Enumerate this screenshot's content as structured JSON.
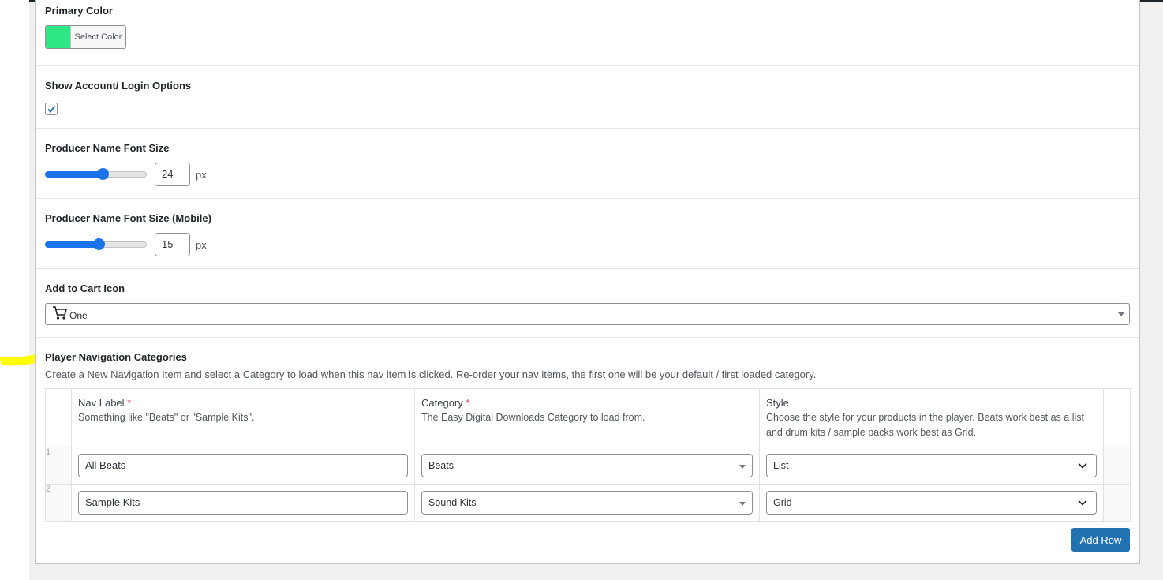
{
  "primary_color": {
    "label": "Primary Color",
    "button_label": "Select Color",
    "swatch_color": "#2ee886"
  },
  "account": {
    "label": "Show Account/ Login Options",
    "checked": true
  },
  "producer_font": {
    "label": "Producer Name Font Size",
    "value": "24",
    "unit": "px",
    "slider_fraction": 0.57
  },
  "producer_font_mobile": {
    "label": "Producer Name Font Size (Mobile)",
    "value": "15",
    "unit": "px",
    "slider_fraction": 0.53
  },
  "cart_icon": {
    "label": "Add to Cart Icon",
    "icon": "shopping-cart-icon",
    "selected": "One"
  },
  "nav": {
    "label": "Player Navigation Categories",
    "description": "Create a New Navigation Item and select a Category to load when this nav item is clicked. Re-order your nav items, the first one will be your default / first loaded category.",
    "columns": [
      {
        "title": "Nav Label",
        "required": "*",
        "desc": "Something like \"Beats\" or \"Sample Kits\"."
      },
      {
        "title": "Category",
        "required": "*",
        "desc": "The Easy Digital Downloads Category to load from."
      },
      {
        "title": "Style",
        "required": "",
        "desc": "Choose the style for your products in the player. Beats work best as a list and drum kits / sample packs work best as Grid."
      }
    ],
    "rows": [
      {
        "order": "1",
        "label": "All Beats",
        "category": "Beats",
        "style": "List"
      },
      {
        "order": "2",
        "label": "Sample Kits",
        "category": "Sound Kits",
        "style": "Grid"
      }
    ],
    "add_row": "Add Row"
  },
  "colors": {
    "accent": "#2271b1",
    "slider": "#1a73e8",
    "highlight": "#ffff00"
  }
}
